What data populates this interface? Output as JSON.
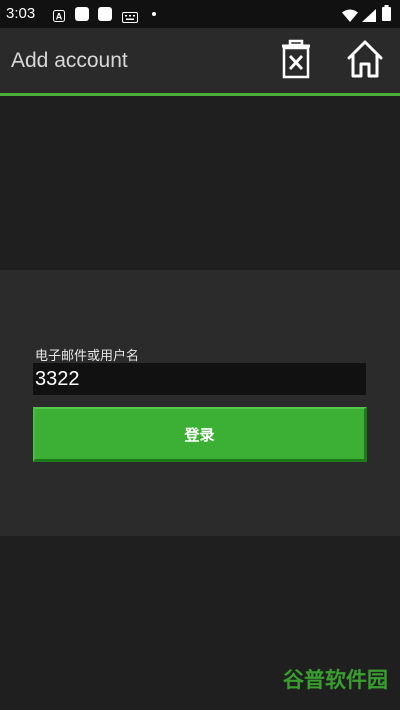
{
  "status_bar": {
    "time": "3:03",
    "icons": [
      "notification-a-icon",
      "square-icon",
      "square-icon",
      "keyboard-icon",
      "dot-icon",
      "wifi-icon",
      "signal-icon",
      "battery-icon"
    ]
  },
  "app_bar": {
    "title": "Add account",
    "delete_icon": "delete-icon",
    "home_icon": "home-icon"
  },
  "colors": {
    "accent": "#4caf3a",
    "button": "#3bb034",
    "background": "#1f1f1f",
    "panel": "#2b2b2b"
  },
  "login": {
    "field_label": "电子邮件或用户名",
    "field_value": "3322",
    "button_label": "登录"
  },
  "watermark": "谷普软件园"
}
